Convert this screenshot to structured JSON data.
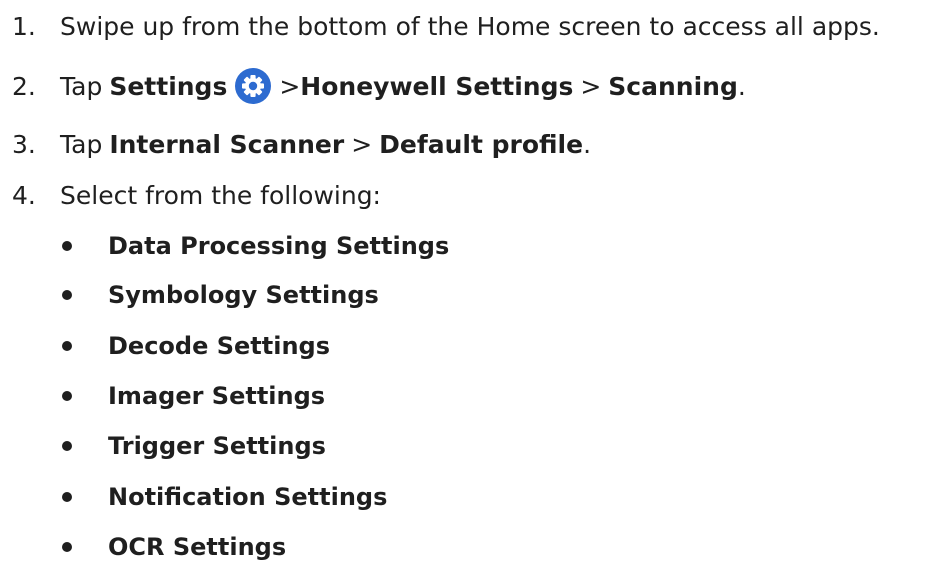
{
  "steps": [
    {
      "number": "1.",
      "text": "Swipe up from the bottom of the Home screen to access all apps."
    },
    {
      "number": "2.",
      "tap": "Tap",
      "settings": "Settings",
      "sep1": ">",
      "honeywell": "Honeywell Settings",
      "sep2": ">",
      "scanning": "Scanning",
      "period": "."
    },
    {
      "number": "3.",
      "tap": "Tap",
      "internal": "Internal Scanner",
      "sep": ">",
      "profile": "Default profile",
      "period": "."
    },
    {
      "number": "4.",
      "text": "Select from the following:"
    }
  ],
  "options": [
    "Data Processing Settings",
    "Symbology Settings",
    "Decode Settings",
    "Imager Settings",
    "Trigger Settings",
    "Notification Settings",
    "OCR Settings"
  ],
  "colors": {
    "text": "#1f1f1f",
    "icon_fill": "#2d6bd0"
  },
  "icons": {
    "settings": "gear-icon"
  }
}
